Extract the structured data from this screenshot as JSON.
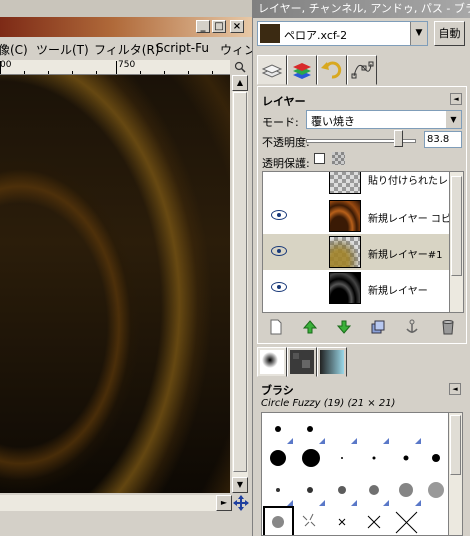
{
  "image_window": {
    "title_buttons": [
      "_",
      "□",
      "×"
    ],
    "menu": [
      "像(C)",
      "ツール(T)",
      "フィルタ(R)",
      "Script-Fu",
      "ウィン"
    ],
    "ruler_labels": [
      "00",
      "750"
    ]
  },
  "dock": {
    "title": "レイヤー, チャンネル, アンドゥ, パス - ブラ...",
    "image_menu_value": "ペロア.xcf-2",
    "auto_button": "自動",
    "tab_icons": [
      "layers-icon",
      "channels-icon",
      "undo-icon",
      "paths-icon"
    ],
    "layers": {
      "title": "レイヤー",
      "mode_label": "モード:",
      "mode_value": "覆い焼き",
      "opacity_label": "不透明度:",
      "opacity_value": "83.8",
      "opacity_fraction": 0.838,
      "lock_label": "透明保護:",
      "items": [
        {
          "name": "貼り付けられたレイヤ",
          "visible": false,
          "selected": false
        },
        {
          "name": "新規レイヤー コピー",
          "visible": true,
          "selected": false
        },
        {
          "name": "新規レイヤー#1",
          "visible": true,
          "selected": true
        },
        {
          "name": "新規レイヤー",
          "visible": true,
          "selected": false
        }
      ],
      "buttons": [
        "new-layer-icon",
        "raise-layer-icon",
        "lower-layer-icon",
        "duplicate-layer-icon",
        "anchor-layer-icon",
        "delete-layer-icon"
      ]
    },
    "brushes": {
      "title": "ブラシ",
      "selected_brush": "Circle Fuzzy (19) (21 × 21)"
    }
  }
}
